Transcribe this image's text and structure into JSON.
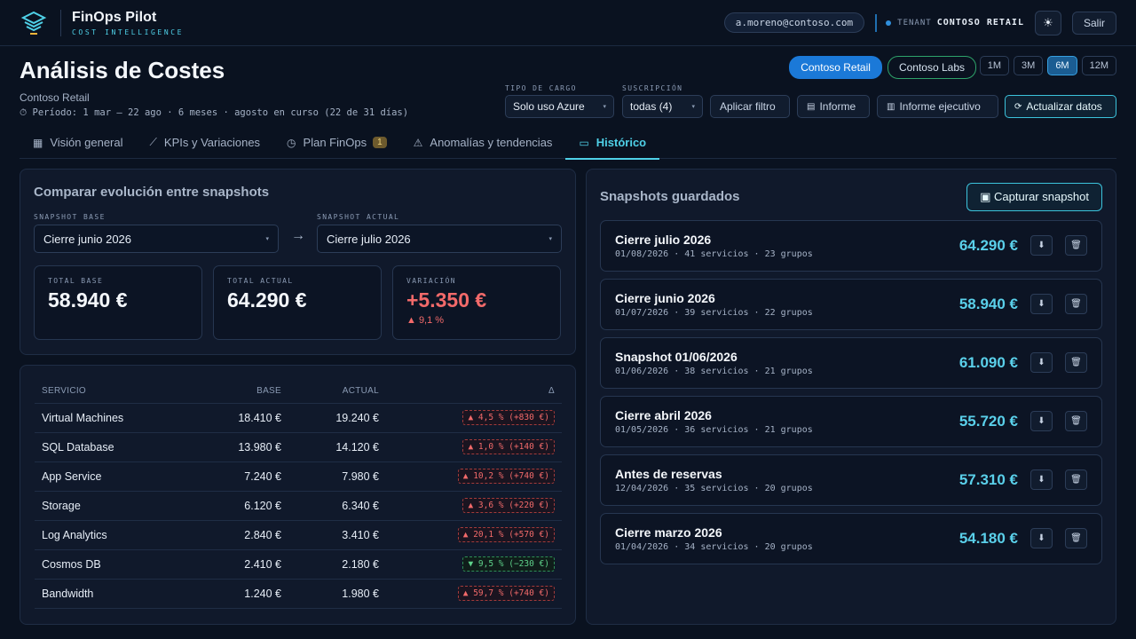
{
  "app": {
    "name": "FinOps Pilot",
    "subtitle": "COST INTELLIGENCE"
  },
  "topbar": {
    "email": "a.moreno@contoso.com",
    "tenant_label": "TENANT",
    "tenant_name": "CONTOSO RETAIL",
    "theme_icon": "sun-icon",
    "logout_label": "Salir"
  },
  "header": {
    "title": "Análisis de Costes",
    "subtitle": "Contoso Retail",
    "period": "Período: 1 mar – 22 ago · 6 meses · agosto en curso (22 de 31 días)"
  },
  "tenants": [
    {
      "label": "Contoso Retail",
      "active": true
    },
    {
      "label": "Contoso Labs",
      "active": false
    }
  ],
  "ranges": [
    {
      "label": "1M",
      "active": false
    },
    {
      "label": "3M",
      "active": false
    },
    {
      "label": "6M",
      "active": true
    },
    {
      "label": "12M",
      "active": false
    }
  ],
  "filters": {
    "charge_type_label": "TIPO DE CARGO",
    "charge_type_value": "Solo uso Azure",
    "subscription_label": "SUSCRIPCIÓN",
    "subscription_value": "todas (4)",
    "apply_label": "Aplicar filtro",
    "report_label": "Informe",
    "exec_report_label": "Informe ejecutivo",
    "refresh_label": "Actualizar datos"
  },
  "tabs": [
    {
      "label": "Visión general",
      "icon": "grid-icon"
    },
    {
      "label": "KPIs y Variaciones",
      "icon": "trend-icon"
    },
    {
      "label": "Plan FinOps",
      "icon": "clock-icon",
      "badge": "1"
    },
    {
      "label": "Anomalías y tendencias",
      "icon": "warning-icon"
    },
    {
      "label": "Histórico",
      "icon": "calendar-icon",
      "active": true
    }
  ],
  "compare": {
    "title": "Comparar evolución entre snapshots",
    "base_label": "SNAPSHOT BASE",
    "base_value": "Cierre junio 2026",
    "current_label": "SNAPSHOT ACTUAL",
    "current_value": "Cierre julio 2026",
    "kpis": {
      "base_label": "TOTAL BASE",
      "base_value": "58.940 €",
      "current_label": "TOTAL ACTUAL",
      "current_value": "64.290 €",
      "variation_label": "VARIACIÓN",
      "variation_value": "+5.350 €",
      "variation_pct": "▲ 9,1 %"
    }
  },
  "services_table": {
    "headers": {
      "service": "SERVICIO",
      "base": "BASE",
      "current": "ACTUAL",
      "delta": "Δ"
    },
    "rows": [
      {
        "service": "Virtual Machines",
        "base": "18.410 €",
        "current": "19.240 €",
        "delta": "▲ 4,5 % (+830 €)",
        "dir": "up"
      },
      {
        "service": "SQL Database",
        "base": "13.980 €",
        "current": "14.120 €",
        "delta": "▲ 1,0 % (+140 €)",
        "dir": "up"
      },
      {
        "service": "App Service",
        "base": "7.240 €",
        "current": "7.980 €",
        "delta": "▲ 10,2 % (+740 €)",
        "dir": "up"
      },
      {
        "service": "Storage",
        "base": "6.120 €",
        "current": "6.340 €",
        "delta": "▲ 3,6 % (+220 €)",
        "dir": "up"
      },
      {
        "service": "Log Analytics",
        "base": "2.840 €",
        "current": "3.410 €",
        "delta": "▲ 20,1 % (+570 €)",
        "dir": "up"
      },
      {
        "service": "Cosmos DB",
        "base": "2.410 €",
        "current": "2.180 €",
        "delta": "▼ 9,5 % (−230 €)",
        "dir": "down"
      },
      {
        "service": "Bandwidth",
        "base": "1.240 €",
        "current": "1.980 €",
        "delta": "▲ 59,7 % (+740 €)",
        "dir": "up"
      }
    ]
  },
  "snapshots": {
    "title": "Snapshots guardados",
    "capture_label": "Capturar snapshot",
    "items": [
      {
        "name": "Cierre julio 2026",
        "meta": "01/08/2026 · 41 servicios · 23 grupos",
        "total": "64.290 €"
      },
      {
        "name": "Cierre junio 2026",
        "meta": "01/07/2026 · 39 servicios · 22 grupos",
        "total": "58.940 €"
      },
      {
        "name": "Snapshot 01/06/2026",
        "meta": "01/06/2026 · 38 servicios · 21 grupos",
        "total": "61.090 €"
      },
      {
        "name": "Cierre abril 2026",
        "meta": "01/05/2026 · 36 servicios · 21 grupos",
        "total": "55.720 €"
      },
      {
        "name": "Antes de reservas",
        "meta": "12/04/2026 · 35 servicios · 20 grupos",
        "total": "57.310 €"
      },
      {
        "name": "Cierre marzo 2026",
        "meta": "01/04/2026 · 34 servicios · 20 grupos",
        "total": "54.180 €"
      }
    ]
  },
  "colors": {
    "accent": "#4fd1e8",
    "primary": "#1b79d8",
    "negative": "#f26a6a",
    "positive": "#5ed18a"
  }
}
